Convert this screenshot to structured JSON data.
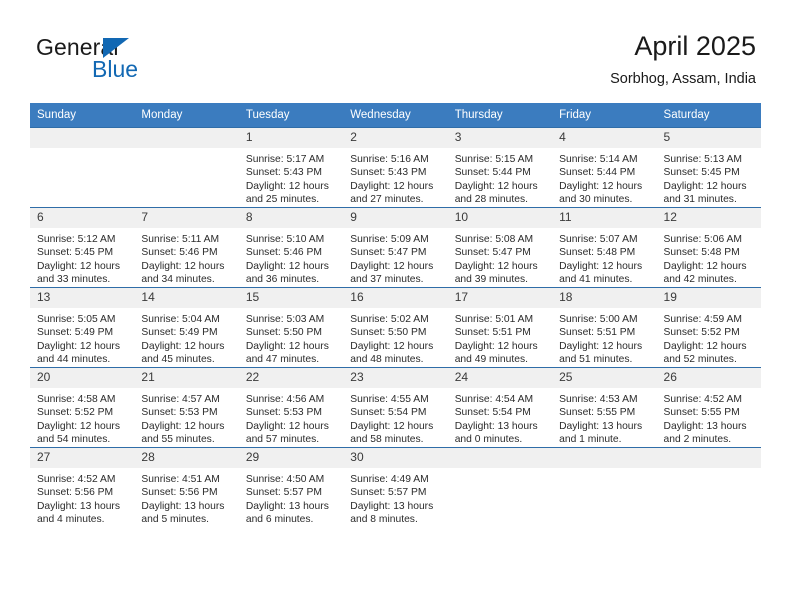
{
  "brand": {
    "name_part1": "General",
    "name_part2": "Blue",
    "logo_icon": "blue-triangle-icon",
    "accent_color": "#1268b3"
  },
  "header": {
    "title": "April 2025",
    "subtitle": "Sorbhog, Assam, India"
  },
  "calendar": {
    "header_bg": "#3b7cbf",
    "row_border": "#2f6da8",
    "daynum_bg": "#f0f0f0",
    "weekday_headers": [
      "Sunday",
      "Monday",
      "Tuesday",
      "Wednesday",
      "Thursday",
      "Friday",
      "Saturday"
    ],
    "weeks": [
      [
        {
          "day": "",
          "empty": true
        },
        {
          "day": "",
          "empty": true
        },
        {
          "day": "1",
          "sunrise": "Sunrise: 5:17 AM",
          "sunset": "Sunset: 5:43 PM",
          "daylight": "Daylight: 12 hours and 25 minutes."
        },
        {
          "day": "2",
          "sunrise": "Sunrise: 5:16 AM",
          "sunset": "Sunset: 5:43 PM",
          "daylight": "Daylight: 12 hours and 27 minutes."
        },
        {
          "day": "3",
          "sunrise": "Sunrise: 5:15 AM",
          "sunset": "Sunset: 5:44 PM",
          "daylight": "Daylight: 12 hours and 28 minutes."
        },
        {
          "day": "4",
          "sunrise": "Sunrise: 5:14 AM",
          "sunset": "Sunset: 5:44 PM",
          "daylight": "Daylight: 12 hours and 30 minutes."
        },
        {
          "day": "5",
          "sunrise": "Sunrise: 5:13 AM",
          "sunset": "Sunset: 5:45 PM",
          "daylight": "Daylight: 12 hours and 31 minutes."
        }
      ],
      [
        {
          "day": "6",
          "sunrise": "Sunrise: 5:12 AM",
          "sunset": "Sunset: 5:45 PM",
          "daylight": "Daylight: 12 hours and 33 minutes."
        },
        {
          "day": "7",
          "sunrise": "Sunrise: 5:11 AM",
          "sunset": "Sunset: 5:46 PM",
          "daylight": "Daylight: 12 hours and 34 minutes."
        },
        {
          "day": "8",
          "sunrise": "Sunrise: 5:10 AM",
          "sunset": "Sunset: 5:46 PM",
          "daylight": "Daylight: 12 hours and 36 minutes."
        },
        {
          "day": "9",
          "sunrise": "Sunrise: 5:09 AM",
          "sunset": "Sunset: 5:47 PM",
          "daylight": "Daylight: 12 hours and 37 minutes."
        },
        {
          "day": "10",
          "sunrise": "Sunrise: 5:08 AM",
          "sunset": "Sunset: 5:47 PM",
          "daylight": "Daylight: 12 hours and 39 minutes."
        },
        {
          "day": "11",
          "sunrise": "Sunrise: 5:07 AM",
          "sunset": "Sunset: 5:48 PM",
          "daylight": "Daylight: 12 hours and 41 minutes."
        },
        {
          "day": "12",
          "sunrise": "Sunrise: 5:06 AM",
          "sunset": "Sunset: 5:48 PM",
          "daylight": "Daylight: 12 hours and 42 minutes."
        }
      ],
      [
        {
          "day": "13",
          "sunrise": "Sunrise: 5:05 AM",
          "sunset": "Sunset: 5:49 PM",
          "daylight": "Daylight: 12 hours and 44 minutes."
        },
        {
          "day": "14",
          "sunrise": "Sunrise: 5:04 AM",
          "sunset": "Sunset: 5:49 PM",
          "daylight": "Daylight: 12 hours and 45 minutes."
        },
        {
          "day": "15",
          "sunrise": "Sunrise: 5:03 AM",
          "sunset": "Sunset: 5:50 PM",
          "daylight": "Daylight: 12 hours and 47 minutes."
        },
        {
          "day": "16",
          "sunrise": "Sunrise: 5:02 AM",
          "sunset": "Sunset: 5:50 PM",
          "daylight": "Daylight: 12 hours and 48 minutes."
        },
        {
          "day": "17",
          "sunrise": "Sunrise: 5:01 AM",
          "sunset": "Sunset: 5:51 PM",
          "daylight": "Daylight: 12 hours and 49 minutes."
        },
        {
          "day": "18",
          "sunrise": "Sunrise: 5:00 AM",
          "sunset": "Sunset: 5:51 PM",
          "daylight": "Daylight: 12 hours and 51 minutes."
        },
        {
          "day": "19",
          "sunrise": "Sunrise: 4:59 AM",
          "sunset": "Sunset: 5:52 PM",
          "daylight": "Daylight: 12 hours and 52 minutes."
        }
      ],
      [
        {
          "day": "20",
          "sunrise": "Sunrise: 4:58 AM",
          "sunset": "Sunset: 5:52 PM",
          "daylight": "Daylight: 12 hours and 54 minutes."
        },
        {
          "day": "21",
          "sunrise": "Sunrise: 4:57 AM",
          "sunset": "Sunset: 5:53 PM",
          "daylight": "Daylight: 12 hours and 55 minutes."
        },
        {
          "day": "22",
          "sunrise": "Sunrise: 4:56 AM",
          "sunset": "Sunset: 5:53 PM",
          "daylight": "Daylight: 12 hours and 57 minutes."
        },
        {
          "day": "23",
          "sunrise": "Sunrise: 4:55 AM",
          "sunset": "Sunset: 5:54 PM",
          "daylight": "Daylight: 12 hours and 58 minutes."
        },
        {
          "day": "24",
          "sunrise": "Sunrise: 4:54 AM",
          "sunset": "Sunset: 5:54 PM",
          "daylight": "Daylight: 13 hours and 0 minutes."
        },
        {
          "day": "25",
          "sunrise": "Sunrise: 4:53 AM",
          "sunset": "Sunset: 5:55 PM",
          "daylight": "Daylight: 13 hours and 1 minute."
        },
        {
          "day": "26",
          "sunrise": "Sunrise: 4:52 AM",
          "sunset": "Sunset: 5:55 PM",
          "daylight": "Daylight: 13 hours and 2 minutes."
        }
      ],
      [
        {
          "day": "27",
          "sunrise": "Sunrise: 4:52 AM",
          "sunset": "Sunset: 5:56 PM",
          "daylight": "Daylight: 13 hours and 4 minutes."
        },
        {
          "day": "28",
          "sunrise": "Sunrise: 4:51 AM",
          "sunset": "Sunset: 5:56 PM",
          "daylight": "Daylight: 13 hours and 5 minutes."
        },
        {
          "day": "29",
          "sunrise": "Sunrise: 4:50 AM",
          "sunset": "Sunset: 5:57 PM",
          "daylight": "Daylight: 13 hours and 6 minutes."
        },
        {
          "day": "30",
          "sunrise": "Sunrise: 4:49 AM",
          "sunset": "Sunset: 5:57 PM",
          "daylight": "Daylight: 13 hours and 8 minutes."
        },
        {
          "day": "",
          "empty": true
        },
        {
          "day": "",
          "empty": true
        },
        {
          "day": "",
          "empty": true
        }
      ]
    ]
  }
}
